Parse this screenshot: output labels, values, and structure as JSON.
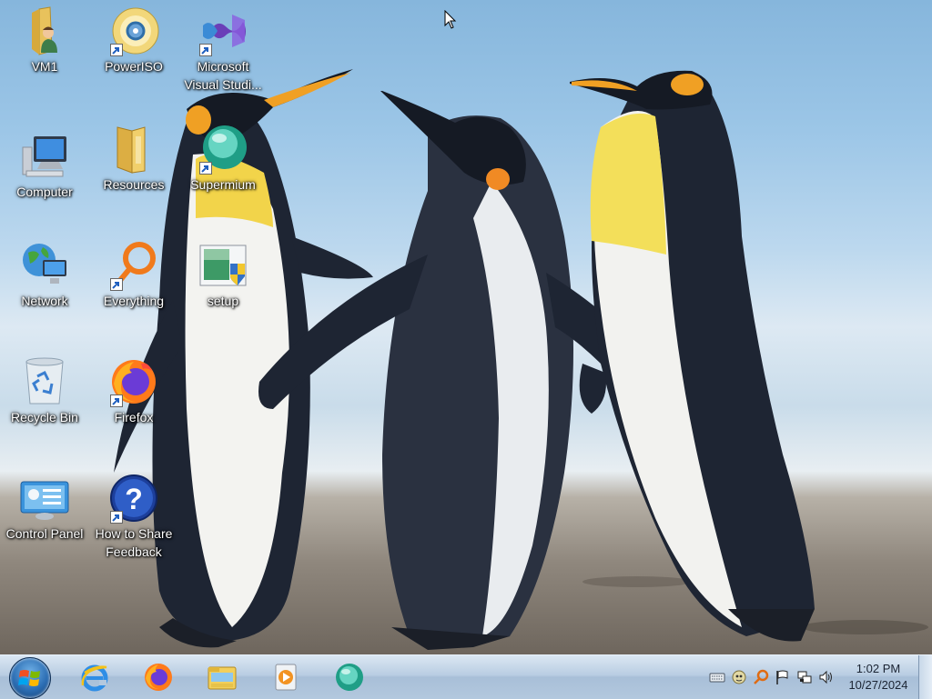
{
  "desktop": {
    "icons": [
      {
        "label": "VM1",
        "icon": "user-folder-icon",
        "shortcut": false
      },
      {
        "label": "PowerISO",
        "icon": "poweriso-disc-icon",
        "shortcut": true
      },
      {
        "label": "Microsoft Visual Studi...",
        "icon": "visual-studio-icon",
        "shortcut": true
      },
      {
        "label": "Computer",
        "icon": "computer-icon",
        "shortcut": false
      },
      {
        "label": "Resources",
        "icon": "folder-icon",
        "shortcut": false
      },
      {
        "label": "Supermium",
        "icon": "supermium-browser-icon",
        "shortcut": true
      },
      {
        "label": "Network",
        "icon": "network-globe-icon",
        "shortcut": false
      },
      {
        "label": "Everything",
        "icon": "everything-search-icon",
        "shortcut": true
      },
      {
        "label": "setup",
        "icon": "setup-installer-icon",
        "shortcut": false
      },
      {
        "label": "Recycle Bin",
        "icon": "recycle-bin-icon",
        "shortcut": false
      },
      {
        "label": "Firefox",
        "icon": "firefox-icon",
        "shortcut": true
      },
      {
        "label": "Control Panel",
        "icon": "control-panel-icon",
        "shortcut": false
      },
      {
        "label": "How to Share Feedback",
        "icon": "help-question-icon",
        "shortcut": true
      }
    ]
  },
  "taskbar": {
    "start": "windows-start-orb-icon",
    "pinned": [
      {
        "name": "Internet Explorer",
        "icon": "internet-explorer-icon"
      },
      {
        "name": "Firefox",
        "icon": "firefox-icon"
      },
      {
        "name": "Windows Explorer",
        "icon": "file-explorer-icon"
      },
      {
        "name": "Media Player",
        "icon": "media-player-icon"
      },
      {
        "name": "Supermium",
        "icon": "supermium-browser-icon"
      }
    ],
    "tray_icons": [
      "keyboard-icon",
      "usb-drive-icon",
      "search-tool-icon",
      "action-center-flag-icon",
      "network-icon",
      "volume-icon"
    ],
    "clock": {
      "time": "1:02 PM",
      "date": "10/27/2024"
    }
  },
  "colors": {
    "taskbar": "#b9cde2",
    "label_text": "#ffffff",
    "clock_text": "#1b2433"
  }
}
